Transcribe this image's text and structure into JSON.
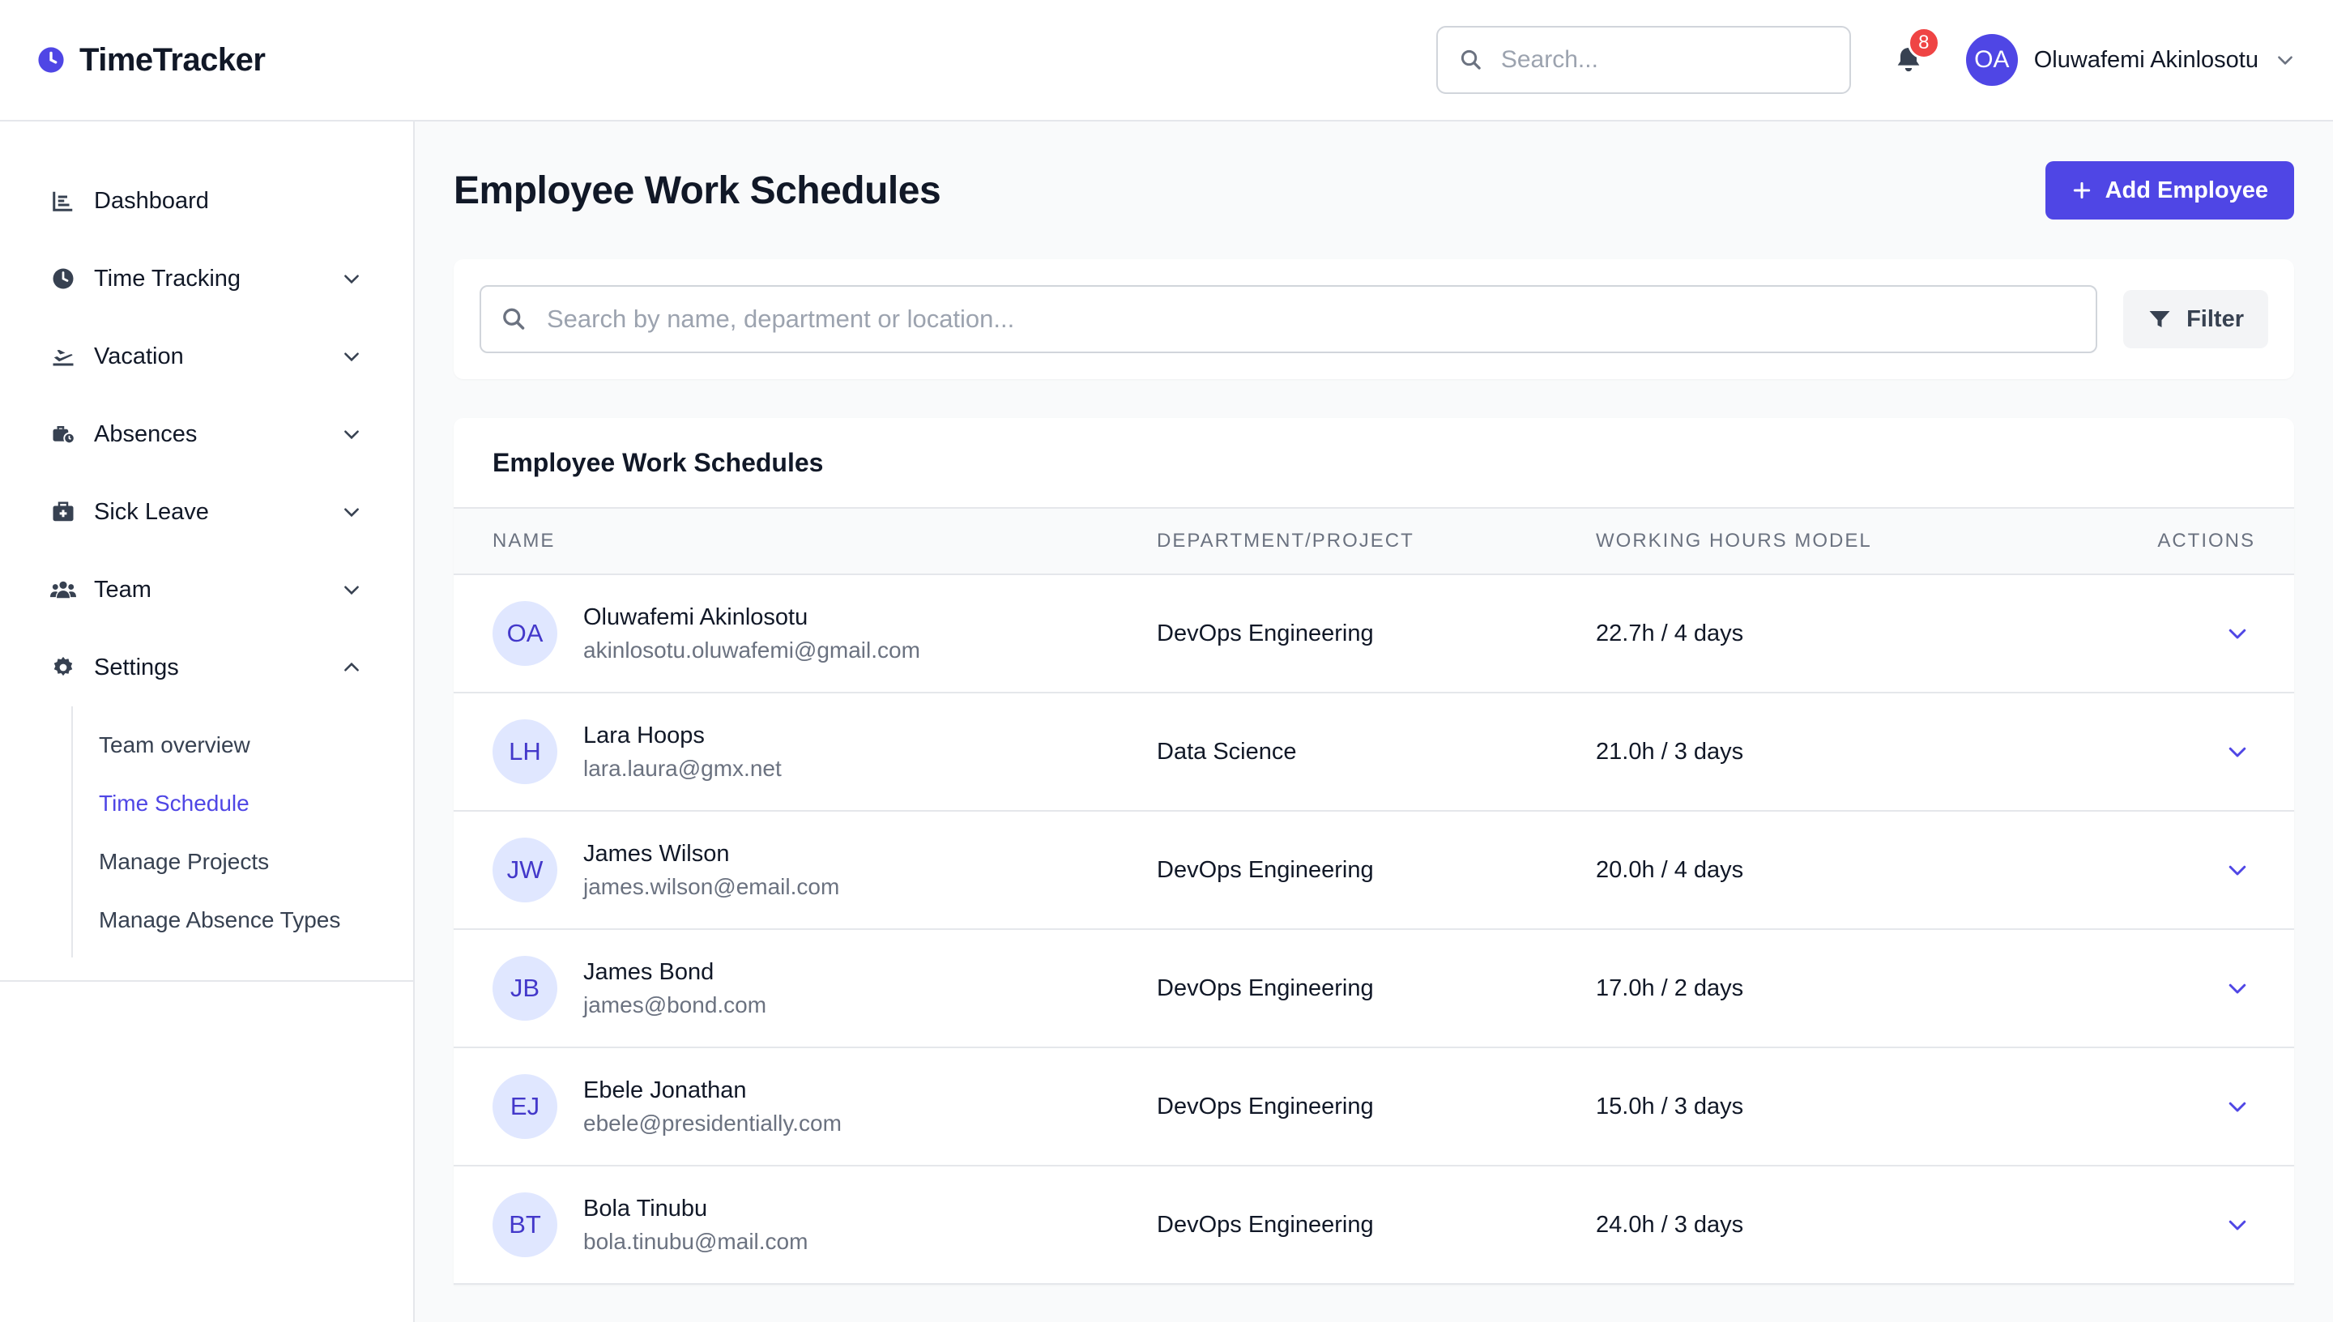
{
  "app": {
    "name": "TimeTracker"
  },
  "header": {
    "search_placeholder": "Search...",
    "notification_count": "8",
    "user": {
      "initials": "OA",
      "name": "Oluwafemi Akinlosotu"
    }
  },
  "sidebar": {
    "items": [
      {
        "label": "Dashboard",
        "icon": "chart-bar-icon"
      },
      {
        "label": "Time Tracking",
        "icon": "clock-icon"
      },
      {
        "label": "Vacation",
        "icon": "plane-icon"
      },
      {
        "label": "Absences",
        "icon": "briefcase-clock-icon"
      },
      {
        "label": "Sick Leave",
        "icon": "medical-kit-icon"
      },
      {
        "label": "Team",
        "icon": "users-icon"
      },
      {
        "label": "Settings",
        "icon": "gear-icon"
      }
    ],
    "settings_sub": [
      {
        "label": "Team overview"
      },
      {
        "label": "Time Schedule",
        "active": true
      },
      {
        "label": "Manage Projects"
      },
      {
        "label": "Manage Absence Types"
      }
    ]
  },
  "main": {
    "title": "Employee Work Schedules",
    "add_button": "Add Employee",
    "filter": {
      "placeholder": "Search by name, department or location...",
      "button": "Filter"
    },
    "table": {
      "title": "Employee Work Schedules",
      "columns": [
        "NAME",
        "DEPARTMENT/PROJECT",
        "WORKING HOURS MODEL",
        "ACTIONS"
      ],
      "rows": [
        {
          "initials": "OA",
          "name": "Oluwafemi Akinlosotu",
          "email": "akinlosotu.oluwafemi@gmail.com",
          "department": "DevOps Engineering",
          "hours": "22.7h / 4 days"
        },
        {
          "initials": "LH",
          "name": "Lara Hoops",
          "email": "lara.laura@gmx.net",
          "department": "Data Science",
          "hours": "21.0h / 3 days"
        },
        {
          "initials": "JW",
          "name": "James Wilson",
          "email": "james.wilson@email.com",
          "department": "DevOps Engineering",
          "hours": "20.0h / 4 days"
        },
        {
          "initials": "JB",
          "name": "James Bond",
          "email": "james@bond.com",
          "department": "DevOps Engineering",
          "hours": "17.0h / 2 days"
        },
        {
          "initials": "EJ",
          "name": "Ebele Jonathan",
          "email": "ebele@presidentially.com",
          "department": "DevOps Engineering",
          "hours": "15.0h / 3 days"
        },
        {
          "initials": "BT",
          "name": "Bola Tinubu",
          "email": "bola.tinubu@mail.com",
          "department": "DevOps Engineering",
          "hours": "24.0h / 3 days"
        }
      ]
    }
  },
  "colors": {
    "accent": "#4f46e5",
    "badge": "#ef4444",
    "avatar_bg": "#e0e7ff"
  }
}
